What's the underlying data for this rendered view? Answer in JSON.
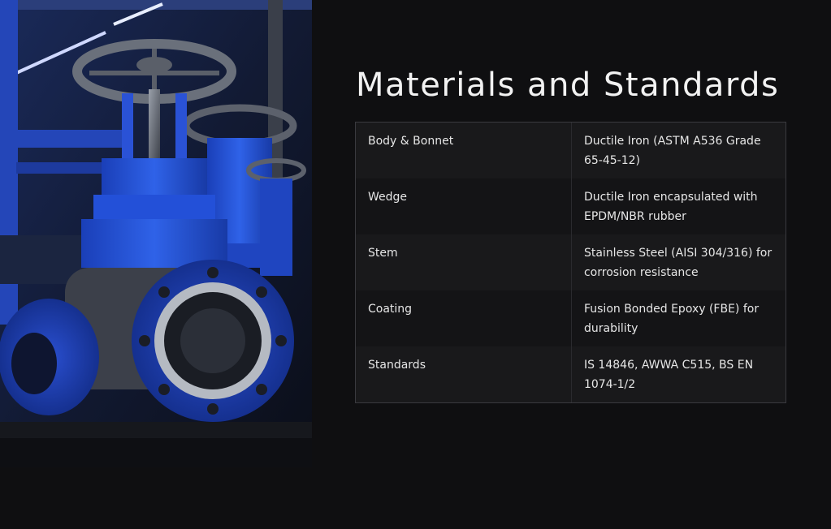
{
  "slide": {
    "title": "Materials and Standards",
    "image_alt": "Blue industrial gate valves"
  },
  "table": {
    "rows": [
      {
        "label": "Body & Bonnet",
        "value": "Ductile Iron (ASTM A536 Grade 65-45-12)"
      },
      {
        "label": "Wedge",
        "value": "Ductile Iron encapsulated with EPDM/NBR rubber"
      },
      {
        "label": "Stem",
        "value": "Stainless Steel (AISI 304/316) for corrosion resistance"
      },
      {
        "label": "Coating",
        "value": "Fusion Bonded Epoxy (FBE) for durability"
      },
      {
        "label": "Standards",
        "value": "IS 14846, AWWA C515, BS EN 1074-1/2"
      }
    ]
  }
}
